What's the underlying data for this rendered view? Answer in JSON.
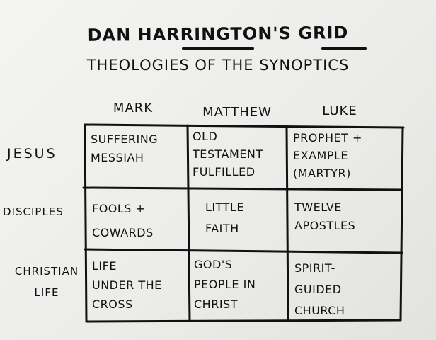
{
  "title": "DAN HARRINGTON'S GRID",
  "subtitle": "THEOLOGIES OF THE SYNOPTICS",
  "columns": [
    "MARK",
    "MATTHEW",
    "LUKE"
  ],
  "rows": [
    "JESUS",
    "DISCIPLES",
    "CHRISTIAN LIFE"
  ],
  "cells": {
    "jesus": [
      "SUFFERING\nMESSIAH",
      "OLD\nTESTAMENT\nFULFILLED",
      "PROPHET +\nEXAMPLE\n(MARTYR)"
    ],
    "disciples": [
      "FOOLS +\nCOWARDS",
      "LITTLE\nFAITH",
      "TWELVE\nAPOSTLES"
    ],
    "christian_life": [
      "LIFE\nUNDER THE\nCROSS",
      "GOD'S\nPEOPLE IN\nCHRIST",
      "SPIRIT-\nGUIDED\nCHURCH"
    ]
  },
  "ink_color": "#111111",
  "background_color": "#efefed"
}
